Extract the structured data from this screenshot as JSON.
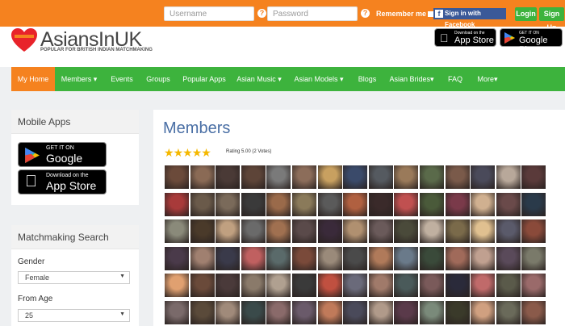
{
  "topbar": {
    "username_placeholder": "Username",
    "password_placeholder": "Password",
    "help": "?",
    "remember_label": "Remember me",
    "facebook_label": "Sign in with Facebook",
    "login_label": "Login",
    "signup_label": "Sign Up"
  },
  "header": {
    "logo_text": "AsiansInUK",
    "logo_tagline": "POPULAR FOR BRITISH INDIAN MATCHMAKING",
    "appstore_small": "Download on the",
    "appstore_big": "App Store",
    "googleplay_small": "GET IT ON",
    "googleplay_big": "Google Play"
  },
  "nav": {
    "items": [
      {
        "label": "My Home"
      },
      {
        "label": "Members ▾"
      },
      {
        "label": "Events"
      },
      {
        "label": "Groups"
      },
      {
        "label": "Popular Apps"
      },
      {
        "label": "Asian Music ▾"
      },
      {
        "label": "Asian Models ▾"
      },
      {
        "label": "Blogs"
      },
      {
        "label": "Asian Brides▾"
      },
      {
        "label": "FAQ"
      },
      {
        "label": "More▾"
      }
    ]
  },
  "sidebar": {
    "mobile_apps": {
      "title": "Mobile Apps",
      "googleplay_small": "GET IT ON",
      "googleplay_big": "Google Play",
      "appstore_small": "Download on the",
      "appstore_big": "App Store"
    },
    "search": {
      "title": "Matchmaking Search",
      "gender_label": "Gender",
      "gender_value": "Female",
      "from_age_label": "From Age",
      "from_age_value": "25"
    }
  },
  "main": {
    "title": "Members",
    "stars": 5,
    "rating_text": "Rating 5.00 (2 Votes)",
    "thumb_colors": [
      "#6b4a3a",
      "#8a6a55",
      "#4a3a36",
      "#5d4438",
      "#7a7a7a",
      "#8c6d5a",
      "#c8a060",
      "#3a4a6a",
      "#555a60",
      "#9a7a5a",
      "#5a6a4a",
      "#7a5a4a",
      "#4a4a5a",
      "#b8a89a",
      "#5a3a3a",
      "#a83a3a",
      "#6a5a4a",
      "#7a6a5a",
      "#3a3a3a",
      "#9a6a4a",
      "#8a7a5a",
      "#5a5a5a",
      "#b06040",
      "#3a2a2a",
      "#c05050",
      "#4a5a3a",
      "#7a3a4a",
      "#d0b090",
      "#6a4a4a",
      "#2a3a4a",
      "#8a8a7a",
      "#4a3a2a",
      "#c0a080",
      "#6a6a6a",
      "#a07050",
      "#5a4a4a",
      "#3a2a3a",
      "#b09070",
      "#6a5a5a",
      "#4a4a3a",
      "#c0b0a0",
      "#7a6a4a",
      "#e0c090",
      "#5a5a6a",
      "#8a4a3a",
      "#4a3a4a",
      "#a08070",
      "#3a3a4a",
      "#c06060",
      "#5a6a6a",
      "#7a4a3a",
      "#9a8a7a",
      "#4a4a4a",
      "#b07a5a",
      "#6a7a8a",
      "#3a4a3a",
      "#a06a5a",
      "#c0a090",
      "#5a4a5a",
      "#7a7a6a",
      "#e0a070",
      "#6a4a3a",
      "#4a3a3a",
      "#8a7a6a",
      "#b0a090",
      "#3a3a3a",
      "#c05040",
      "#6a6a7a",
      "#a07a6a",
      "#4a5a5a",
      "#7a5a5a",
      "#2a2a3a",
      "#c06a6a",
      "#5a5a4a",
      "#9a6a6a",
      "#7a6a6a",
      "#5a4a3a",
      "#a08a7a",
      "#3a4a4a",
      "#8a6a6a",
      "#6a5a6a",
      "#c07a5a",
      "#4a4a5a",
      "#b09a8a",
      "#5a3a4a",
      "#7a8a7a",
      "#3a3a2a",
      "#d0a080",
      "#6a6a5a",
      "#8a5a4a"
    ]
  }
}
